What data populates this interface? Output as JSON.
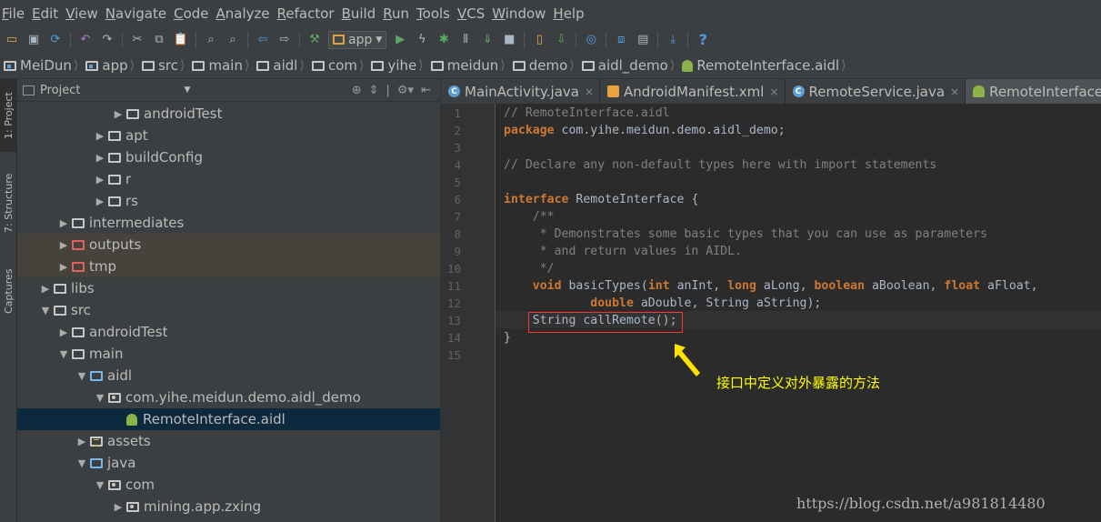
{
  "menu": [
    "File",
    "Edit",
    "View",
    "Navigate",
    "Code",
    "Analyze",
    "Refactor",
    "Build",
    "Run",
    "Tools",
    "VCS",
    "Window",
    "Help"
  ],
  "toolbar": {
    "run_config": "app",
    "icons": [
      "open-icon",
      "save-icon",
      "sync-icon",
      "undo-icon",
      "redo-icon",
      "cut-icon",
      "copy-icon",
      "paste-icon",
      "find-icon",
      "replace-icon",
      "back-icon",
      "forward-icon",
      "make-icon",
      "run-icon",
      "apply-changes-icon",
      "debug-icon",
      "coverage-icon",
      "attach-debugger-icon",
      "stop-icon",
      "avd-manager-icon",
      "sdk-manager-icon",
      "project-structure-icon",
      "sync-gradle-icon",
      "help-icon"
    ]
  },
  "breadcrumb": [
    "MeiDun",
    "app",
    "src",
    "main",
    "aidl",
    "com",
    "yihe",
    "meidun",
    "demo",
    "aidl_demo",
    "RemoteInterface.aidl"
  ],
  "left_strip": {
    "project_tab": "1: Project",
    "structure_tab": "7: Structure",
    "captures_tab": "Captures"
  },
  "project_panel": {
    "title": "Project",
    "tree": [
      {
        "label": "androidTest",
        "indent": 6,
        "arrow": "collapsed",
        "icon": "folder"
      },
      {
        "label": "apt",
        "indent": 5,
        "arrow": "collapsed",
        "icon": "folder"
      },
      {
        "label": "buildConfig",
        "indent": 5,
        "arrow": "collapsed",
        "icon": "folder"
      },
      {
        "label": "r",
        "indent": 5,
        "arrow": "collapsed",
        "icon": "folder"
      },
      {
        "label": "rs",
        "indent": 5,
        "arrow": "collapsed",
        "icon": "folder"
      },
      {
        "label": "intermediates",
        "indent": 3,
        "arrow": "collapsed",
        "icon": "folder"
      },
      {
        "label": "outputs",
        "indent": 3,
        "arrow": "collapsed",
        "icon": "folder-red",
        "highlight": true
      },
      {
        "label": "tmp",
        "indent": 3,
        "arrow": "collapsed",
        "icon": "folder-red",
        "highlight": true
      },
      {
        "label": "libs",
        "indent": 2,
        "arrow": "collapsed",
        "icon": "folder"
      },
      {
        "label": "src",
        "indent": 2,
        "arrow": "expanded",
        "icon": "folder"
      },
      {
        "label": "androidTest",
        "indent": 3,
        "arrow": "collapsed",
        "icon": "folder"
      },
      {
        "label": "main",
        "indent": 3,
        "arrow": "expanded",
        "icon": "folder"
      },
      {
        "label": "aidl",
        "indent": 4,
        "arrow": "expanded",
        "icon": "folder-blue"
      },
      {
        "label": "com.yihe.meidun.demo.aidl_demo",
        "indent": 5,
        "arrow": "expanded",
        "icon": "package"
      },
      {
        "label": "RemoteInterface.aidl",
        "indent": 6,
        "arrow": "none",
        "icon": "android",
        "selected": true
      },
      {
        "label": "assets",
        "indent": 4,
        "arrow": "collapsed",
        "icon": "folder-assets"
      },
      {
        "label": "java",
        "indent": 4,
        "arrow": "expanded",
        "icon": "folder-blue"
      },
      {
        "label": "com",
        "indent": 5,
        "arrow": "expanded",
        "icon": "package"
      },
      {
        "label": "mining.app.zxing",
        "indent": 6,
        "arrow": "collapsed",
        "icon": "package"
      }
    ]
  },
  "editor": {
    "tabs": [
      {
        "label": "MainActivity.java",
        "icon": "C",
        "active": false
      },
      {
        "label": "AndroidManifest.xml",
        "icon": "xml",
        "active": false
      },
      {
        "label": "RemoteService.java",
        "icon": "C",
        "active": false
      },
      {
        "label": "RemoteInterface.aidl",
        "icon": "android",
        "active": true
      }
    ],
    "line_numbers": [
      "1",
      "2",
      "3",
      "4",
      "5",
      "6",
      "7",
      "8",
      "9",
      "10",
      "11",
      "12",
      "13",
      "14",
      "15"
    ],
    "lines": [
      [
        {
          "t": "// RemoteInterface.aidl",
          "c": "cm"
        }
      ],
      [
        {
          "t": "package",
          "c": "kw"
        },
        {
          "t": " com.yihe.meidun.demo.aidl_demo;",
          "c": ""
        }
      ],
      [],
      [
        {
          "t": "// Declare any non-default types here with import statements",
          "c": "cm"
        }
      ],
      [],
      [
        {
          "t": "interface",
          "c": "kw"
        },
        {
          "t": " RemoteInterface {",
          "c": ""
        }
      ],
      [
        {
          "t": "    /**",
          "c": "cm"
        }
      ],
      [
        {
          "t": "     * Demonstrates some basic types that you can use as parameters",
          "c": "cm"
        }
      ],
      [
        {
          "t": "     * and return values in AIDL.",
          "c": "cm"
        }
      ],
      [
        {
          "t": "     */",
          "c": "cm"
        }
      ],
      [
        {
          "t": "    ",
          "c": ""
        },
        {
          "t": "void",
          "c": "kw"
        },
        {
          "t": " basicTypes(",
          "c": ""
        },
        {
          "t": "int",
          "c": "kw"
        },
        {
          "t": " anInt, ",
          "c": ""
        },
        {
          "t": "long",
          "c": "kw"
        },
        {
          "t": " aLong, ",
          "c": ""
        },
        {
          "t": "boolean",
          "c": "kw"
        },
        {
          "t": " aBoolean, ",
          "c": ""
        },
        {
          "t": "float",
          "c": "kw"
        },
        {
          "t": " aFloat,",
          "c": ""
        }
      ],
      [
        {
          "t": "            ",
          "c": ""
        },
        {
          "t": "double",
          "c": "kw"
        },
        {
          "t": " aDouble, String aString);",
          "c": ""
        }
      ],
      [
        {
          "t": "    String callRemote();",
          "c": ""
        }
      ],
      [
        {
          "t": "}",
          "c": ""
        }
      ],
      []
    ]
  },
  "annotation": "接口中定义对外暴露的方法",
  "watermark": "https://blog.csdn.net/a981814480"
}
